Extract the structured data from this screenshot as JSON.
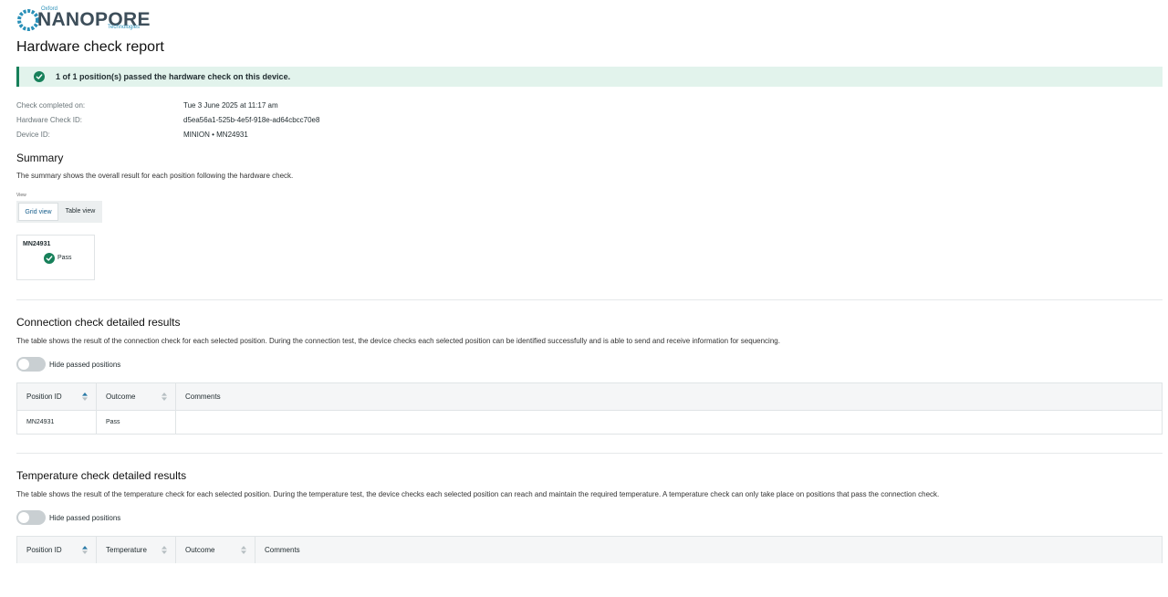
{
  "logo": {
    "small_top": "Oxford",
    "main": "NANOPORE",
    "small_bottom": "Technologies"
  },
  "page_title": "Hardware check report",
  "banner": {
    "text": "1 of 1 position(s) passed the hardware check on this device."
  },
  "meta": [
    {
      "label": "Check completed on:",
      "value": "Tue 3 June 2025 at 11:17 am"
    },
    {
      "label": "Hardware Check ID:",
      "value": "d5ea56a1-525b-4e5f-918e-ad64cbcc70e8"
    },
    {
      "label": "Device ID:",
      "value": "MINION • MN24931"
    }
  ],
  "summary": {
    "title": "Summary",
    "description": "The summary shows the overall result for each position following the hardware check.",
    "view_label": "View",
    "grid_label": "Grid view",
    "table_label": "Table view",
    "card": {
      "name": "MN24931",
      "status": "Pass"
    }
  },
  "connection": {
    "title": "Connection check detailed results",
    "description": "The table shows the result of the connection check for each selected position. During the connection test, the device checks each selected position can be identified successfully and is able to send and receive information for sequencing.",
    "toggle_label": "Hide passed positions",
    "columns": [
      "Position ID",
      "Outcome",
      "Comments"
    ],
    "rows": [
      [
        "MN24931",
        "Pass",
        ""
      ]
    ]
  },
  "temperature": {
    "title": "Temperature check detailed results",
    "description": "The table shows the result of the temperature check for each selected position. During the temperature test, the device checks each selected position can reach and maintain the required temperature. A temperature check can only take place on positions that pass the connection check.",
    "toggle_label": "Hide passed positions",
    "columns": [
      "Position ID",
      "Temperature",
      "Outcome",
      "Comments"
    ]
  },
  "colors": {
    "pass_green": "#17805a",
    "banner_bg": "#e2f3ec",
    "sort_active": "#2a7aa6",
    "link_blue": "#145c8a"
  }
}
